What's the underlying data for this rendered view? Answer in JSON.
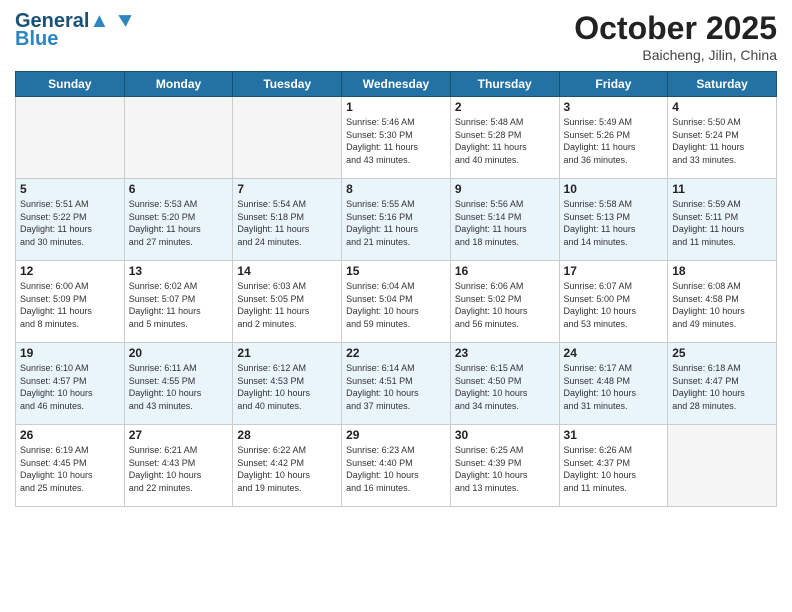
{
  "header": {
    "logo_line1": "General",
    "logo_line2": "Blue",
    "month": "October 2025",
    "location": "Baicheng, Jilin, China"
  },
  "days_of_week": [
    "Sunday",
    "Monday",
    "Tuesday",
    "Wednesday",
    "Thursday",
    "Friday",
    "Saturday"
  ],
  "weeks": [
    [
      {
        "day": "",
        "info": ""
      },
      {
        "day": "",
        "info": ""
      },
      {
        "day": "",
        "info": ""
      },
      {
        "day": "1",
        "info": "Sunrise: 5:46 AM\nSunset: 5:30 PM\nDaylight: 11 hours\nand 43 minutes."
      },
      {
        "day": "2",
        "info": "Sunrise: 5:48 AM\nSunset: 5:28 PM\nDaylight: 11 hours\nand 40 minutes."
      },
      {
        "day": "3",
        "info": "Sunrise: 5:49 AM\nSunset: 5:26 PM\nDaylight: 11 hours\nand 36 minutes."
      },
      {
        "day": "4",
        "info": "Sunrise: 5:50 AM\nSunset: 5:24 PM\nDaylight: 11 hours\nand 33 minutes."
      }
    ],
    [
      {
        "day": "5",
        "info": "Sunrise: 5:51 AM\nSunset: 5:22 PM\nDaylight: 11 hours\nand 30 minutes."
      },
      {
        "day": "6",
        "info": "Sunrise: 5:53 AM\nSunset: 5:20 PM\nDaylight: 11 hours\nand 27 minutes."
      },
      {
        "day": "7",
        "info": "Sunrise: 5:54 AM\nSunset: 5:18 PM\nDaylight: 11 hours\nand 24 minutes."
      },
      {
        "day": "8",
        "info": "Sunrise: 5:55 AM\nSunset: 5:16 PM\nDaylight: 11 hours\nand 21 minutes."
      },
      {
        "day": "9",
        "info": "Sunrise: 5:56 AM\nSunset: 5:14 PM\nDaylight: 11 hours\nand 18 minutes."
      },
      {
        "day": "10",
        "info": "Sunrise: 5:58 AM\nSunset: 5:13 PM\nDaylight: 11 hours\nand 14 minutes."
      },
      {
        "day": "11",
        "info": "Sunrise: 5:59 AM\nSunset: 5:11 PM\nDaylight: 11 hours\nand 11 minutes."
      }
    ],
    [
      {
        "day": "12",
        "info": "Sunrise: 6:00 AM\nSunset: 5:09 PM\nDaylight: 11 hours\nand 8 minutes."
      },
      {
        "day": "13",
        "info": "Sunrise: 6:02 AM\nSunset: 5:07 PM\nDaylight: 11 hours\nand 5 minutes."
      },
      {
        "day": "14",
        "info": "Sunrise: 6:03 AM\nSunset: 5:05 PM\nDaylight: 11 hours\nand 2 minutes."
      },
      {
        "day": "15",
        "info": "Sunrise: 6:04 AM\nSunset: 5:04 PM\nDaylight: 10 hours\nand 59 minutes."
      },
      {
        "day": "16",
        "info": "Sunrise: 6:06 AM\nSunset: 5:02 PM\nDaylight: 10 hours\nand 56 minutes."
      },
      {
        "day": "17",
        "info": "Sunrise: 6:07 AM\nSunset: 5:00 PM\nDaylight: 10 hours\nand 53 minutes."
      },
      {
        "day": "18",
        "info": "Sunrise: 6:08 AM\nSunset: 4:58 PM\nDaylight: 10 hours\nand 49 minutes."
      }
    ],
    [
      {
        "day": "19",
        "info": "Sunrise: 6:10 AM\nSunset: 4:57 PM\nDaylight: 10 hours\nand 46 minutes."
      },
      {
        "day": "20",
        "info": "Sunrise: 6:11 AM\nSunset: 4:55 PM\nDaylight: 10 hours\nand 43 minutes."
      },
      {
        "day": "21",
        "info": "Sunrise: 6:12 AM\nSunset: 4:53 PM\nDaylight: 10 hours\nand 40 minutes."
      },
      {
        "day": "22",
        "info": "Sunrise: 6:14 AM\nSunset: 4:51 PM\nDaylight: 10 hours\nand 37 minutes."
      },
      {
        "day": "23",
        "info": "Sunrise: 6:15 AM\nSunset: 4:50 PM\nDaylight: 10 hours\nand 34 minutes."
      },
      {
        "day": "24",
        "info": "Sunrise: 6:17 AM\nSunset: 4:48 PM\nDaylight: 10 hours\nand 31 minutes."
      },
      {
        "day": "25",
        "info": "Sunrise: 6:18 AM\nSunset: 4:47 PM\nDaylight: 10 hours\nand 28 minutes."
      }
    ],
    [
      {
        "day": "26",
        "info": "Sunrise: 6:19 AM\nSunset: 4:45 PM\nDaylight: 10 hours\nand 25 minutes."
      },
      {
        "day": "27",
        "info": "Sunrise: 6:21 AM\nSunset: 4:43 PM\nDaylight: 10 hours\nand 22 minutes."
      },
      {
        "day": "28",
        "info": "Sunrise: 6:22 AM\nSunset: 4:42 PM\nDaylight: 10 hours\nand 19 minutes."
      },
      {
        "day": "29",
        "info": "Sunrise: 6:23 AM\nSunset: 4:40 PM\nDaylight: 10 hours\nand 16 minutes."
      },
      {
        "day": "30",
        "info": "Sunrise: 6:25 AM\nSunset: 4:39 PM\nDaylight: 10 hours\nand 13 minutes."
      },
      {
        "day": "31",
        "info": "Sunrise: 6:26 AM\nSunset: 4:37 PM\nDaylight: 10 hours\nand 11 minutes."
      },
      {
        "day": "",
        "info": ""
      }
    ]
  ]
}
